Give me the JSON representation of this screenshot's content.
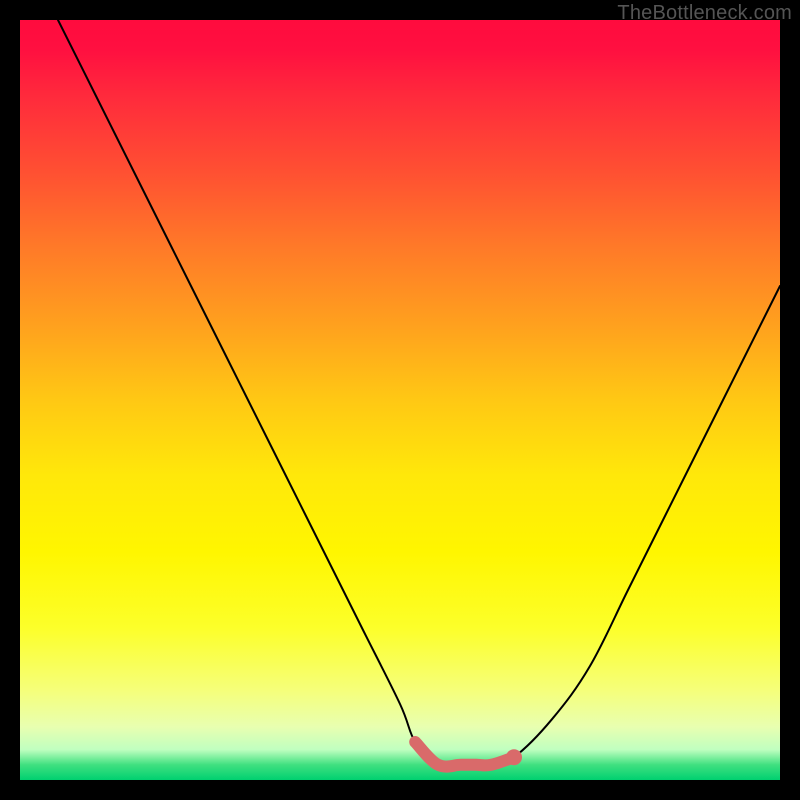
{
  "watermark": "TheBottleneck.com",
  "chart_data": {
    "type": "line",
    "title": "",
    "xlabel": "",
    "ylabel": "",
    "xlim": [
      0,
      100
    ],
    "ylim": [
      0,
      100
    ],
    "series": [
      {
        "name": "bottleneck-curve",
        "x": [
          5,
          10,
          15,
          20,
          25,
          30,
          35,
          40,
          45,
          50,
          52,
          55,
          58,
          60,
          62,
          65,
          70,
          75,
          80,
          85,
          90,
          95,
          100
        ],
        "y": [
          100,
          90,
          80,
          70,
          60,
          50,
          40,
          30,
          20,
          10,
          5,
          2,
          2,
          2,
          2,
          3,
          8,
          15,
          25,
          35,
          45,
          55,
          65
        ]
      }
    ],
    "marker_region": {
      "name": "optimal-zone",
      "x": [
        52,
        55,
        58,
        60,
        62,
        65
      ],
      "y": [
        5,
        2,
        2,
        2,
        2,
        3
      ],
      "color": "#d96a6a"
    },
    "gradient_stops": [
      {
        "pos": 0,
        "color": "#ff0b3e"
      },
      {
        "pos": 50,
        "color": "#ffc814"
      },
      {
        "pos": 80,
        "color": "#fcff2a"
      },
      {
        "pos": 100,
        "color": "#00d070"
      }
    ]
  }
}
